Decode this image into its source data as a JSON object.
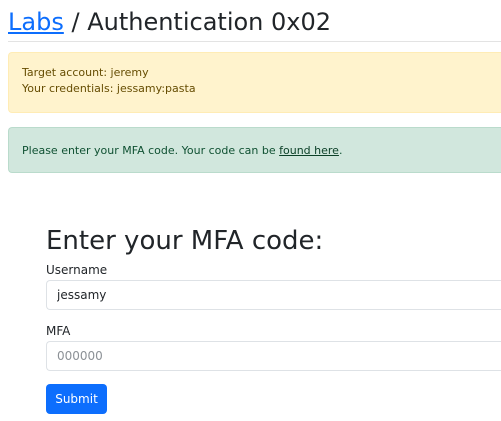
{
  "header": {
    "link_text": "Labs",
    "separator": "/",
    "title": "Authentication 0x02"
  },
  "warning_alert": {
    "line1": "Target account: jeremy",
    "line2": "Your credentials: jessamy:pasta"
  },
  "info_alert": {
    "text_before": "Please enter your MFA code. Your code can be",
    "link_text": "found here",
    "text_after": "."
  },
  "form": {
    "title": "Enter your MFA code:",
    "username_label": "Username",
    "username_value": "jessamy",
    "mfa_label": "MFA",
    "mfa_placeholder": "000000",
    "submit_label": "Submit"
  },
  "colors": {
    "link": "#0d6efd",
    "primary_button": "#0d6efd",
    "warning_bg": "#fff3cd",
    "warning_text": "#664d03",
    "success_bg": "#d1e7dd",
    "success_text": "#0f5132"
  }
}
